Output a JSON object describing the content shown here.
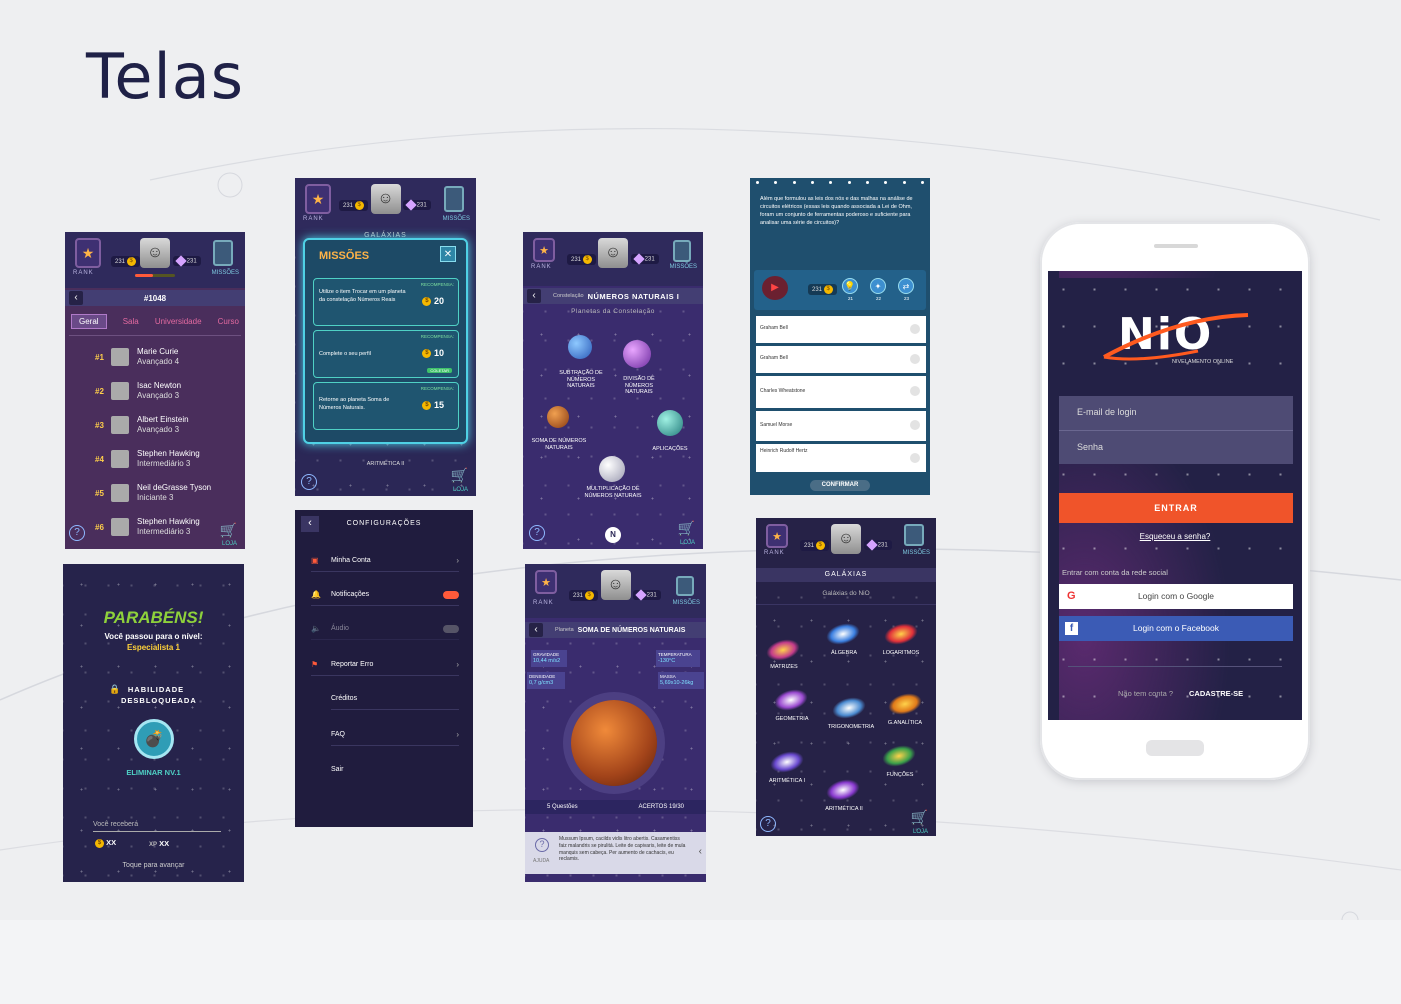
{
  "page": {
    "title": "Telas"
  },
  "common": {
    "rank_label": "RANK",
    "missions_label": "MISSÕES",
    "shop_label": "LOJA",
    "coins": "231",
    "gems": "231",
    "help_icon": "?"
  },
  "rank_screen": {
    "nav_title": "#1048",
    "tabs": [
      "Geral",
      "Sala",
      "Universidade",
      "Curso"
    ],
    "rows": [
      {
        "pos": "#1",
        "name": "Marie Curie",
        "level": "Avançado 4"
      },
      {
        "pos": "#2",
        "name": "Isac Newton",
        "level": "Avançado 3"
      },
      {
        "pos": "#3",
        "name": "Albert Einstein",
        "level": "Avançado 3"
      },
      {
        "pos": "#4",
        "name": "Stephen Hawking",
        "level": "Intermediário 3"
      },
      {
        "pos": "#5",
        "name": "Neil deGrasse Tyson",
        "level": "Iniciante 3"
      },
      {
        "pos": "#6",
        "name": "Stephen Hawking",
        "level": "Intermediário 3"
      }
    ]
  },
  "missions_screen": {
    "title": "MISSÕES",
    "close": "✕",
    "behind": "GALÁXIAS",
    "behind_item": "ARITMÉTICA II",
    "reward_label": "RECOMPENSA:",
    "missions": [
      {
        "text": "Utilize o item Trocar em um planeta da constelação Números Reais",
        "reward": "20",
        "badge": ""
      },
      {
        "text": "Complete o seu perfil",
        "reward": "10",
        "badge": "COLETAR"
      },
      {
        "text": "Retorne ao planeta Soma de Números Naturais.",
        "reward": "15",
        "badge": ""
      }
    ]
  },
  "constellation_screen": {
    "nav_prefix": "Constelação",
    "nav_title": "NÚMEROS NATURAIS I",
    "subtitle": "Planetas da Constelação",
    "planets": [
      "SUBTRAÇÃO DE NÚMEROS NATURAIS",
      "DIVISÃO DE NÚMEROS NATURAIS",
      "SOMA DE NÚMEROS NATURAIS",
      "APLICAÇÕES",
      "MULTIPLICAÇÃO DE NÚMEROS NATURAIS"
    ]
  },
  "quiz_screen": {
    "question": "Além que formulou as leis dos nós e das malhas na análise de circuitos elétricos (essas leis quando associada a Lei de Ohm, foram um conjunto de ferramentas poderoso e suficiente para analisar uma série de circuitos)?",
    "powerups": [
      "21",
      "22",
      "23"
    ],
    "coins": "231",
    "options": [
      "Graham Bell",
      "Graham Bell",
      "Charles Wheatstone",
      "Samuel Morse",
      "Heinrich Rudolf Hertz"
    ],
    "confirm": "CONFIRMAR"
  },
  "login_screen": {
    "logo": "NiO",
    "logo_sub": "NIVELAMENTO ONLINE",
    "email_placeholder": "E-mail de login",
    "password_placeholder": "Senha",
    "enter": "ENTRAR",
    "forgot": "Esqueceu a senha?",
    "social_label": "Entrar com conta da rede social",
    "google": "Login com o Google",
    "facebook": "Login com o Facebook",
    "no_account": "Não tem conta ?",
    "signup": "CADASTRE-SE"
  },
  "congrats_screen": {
    "title": "PARABÉNS!",
    "subtitle": "Você passou para o nível:",
    "level": "Especialista 1",
    "skill": "HABILIDADE DESBLOQUEADA",
    "item": "ELIMINAR NV.1",
    "receive": "Você receberá",
    "coins": "XX",
    "xp_label": "XP",
    "xp": "XX",
    "continue": "Toque para avançar"
  },
  "settings_screen": {
    "title": "CONFIGURAÇÕES",
    "items": [
      "Minha Conta",
      "Notificações",
      "Áudio",
      "Reportar Erro",
      "Créditos",
      "FAQ",
      "Sair"
    ]
  },
  "planet_screen": {
    "nav_prefix": "Planeta",
    "nav_title": "SOMA DE NÚMEROS NATURAIS",
    "gravity_label": "GRAVIDADE",
    "gravity": "10,44 m/s2",
    "temp_label": "TEMPERATURA",
    "temp": "-130°C",
    "density_label": "DENSIDADE",
    "density": "0,7 g/cm3",
    "mass_label": "MASSA",
    "mass": "5,69x10-26kg",
    "questions": "5 Questões",
    "hits": "ACERTOS 19/30",
    "help_label": "AJUDA",
    "help_text": "Mussum Ipsum, cacilds vidis litro abertis. Casamentiss faiz malandris se pirulitá. Leite de capivaris, leite de mula manquis sem cabeça. Per aumento de cachacis, eu reclamis."
  },
  "galaxies_screen": {
    "title": "GALÁXIAS",
    "subtitle": "Galáxias do NiO",
    "galaxies": [
      "MATRIZES",
      "ÁLGEBRA",
      "LOGARITMOS",
      "GEOMETRIA",
      "TRIGONOMETRIA",
      "G.ANALÍTICA",
      "ARITMÉTICA I",
      "FUNÇÕES",
      "ARITMÉTICA II"
    ]
  }
}
